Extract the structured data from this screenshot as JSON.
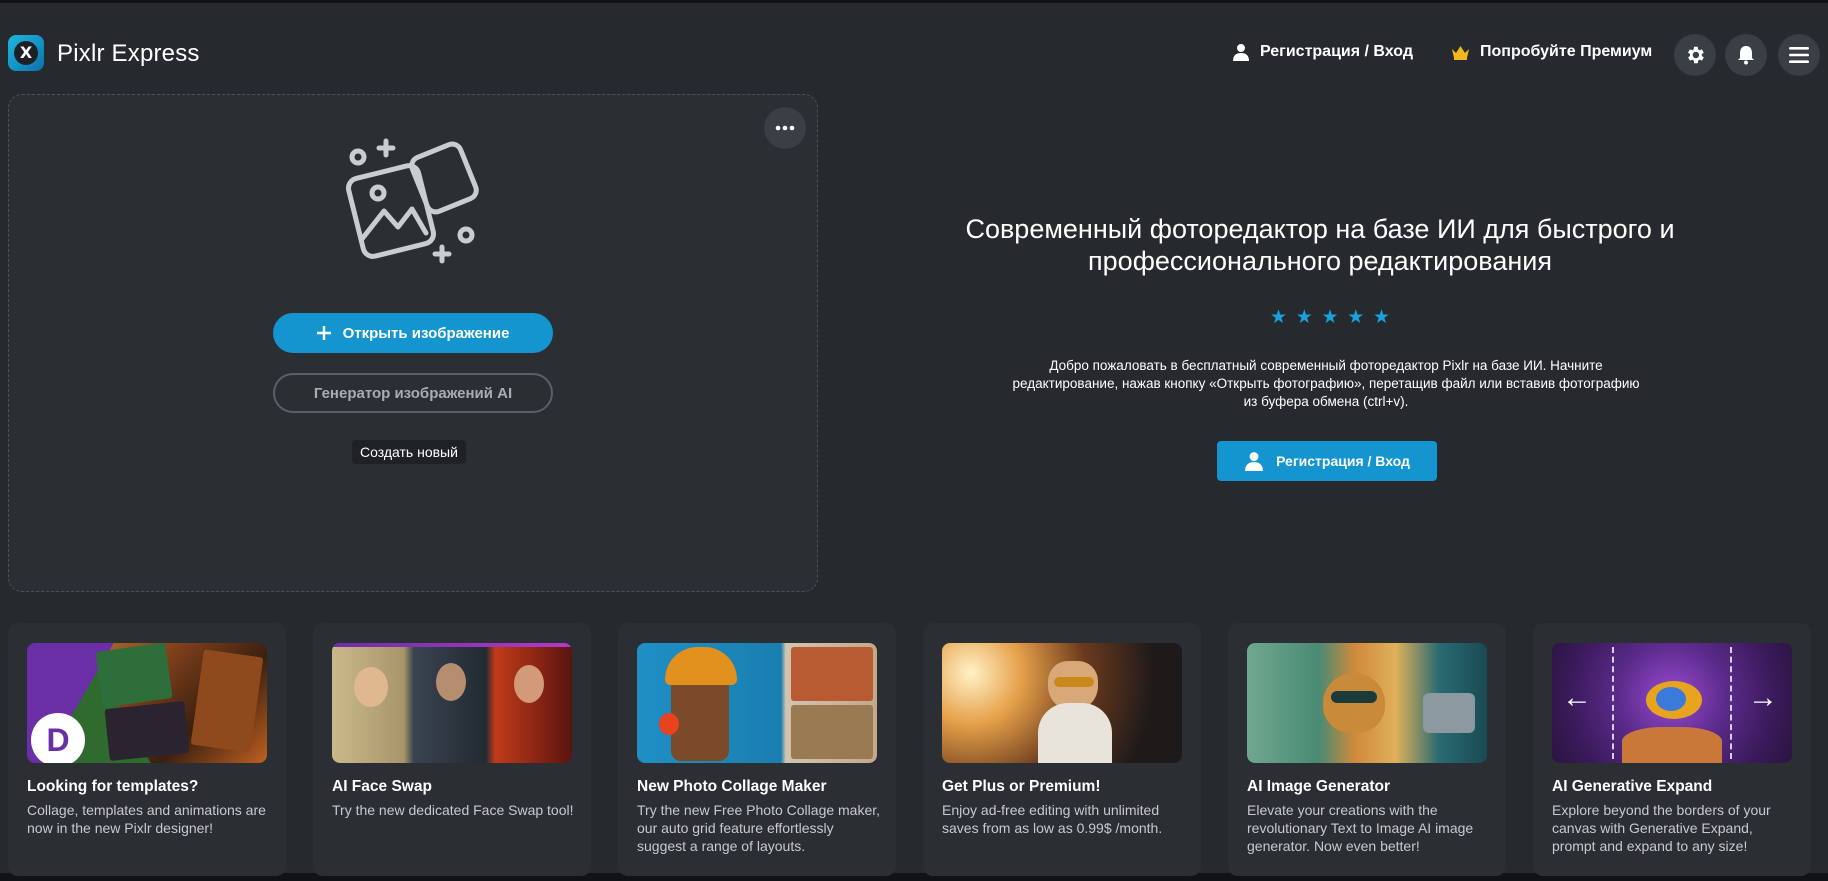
{
  "app": {
    "brand": "Pixlr Express",
    "logo_letter": "X"
  },
  "header": {
    "login_label": "Регистрация / Вход",
    "premium_label": "Попробуйте Премиум",
    "icons": [
      "user-icon",
      "crown-icon",
      "gear-icon",
      "bell-icon",
      "menu-icon"
    ]
  },
  "open_panel": {
    "open_button": "Открыть изображение",
    "ai_generator_button": "Генератор изображений AI",
    "create_new": "Создать новый"
  },
  "hero": {
    "title": "Современный фоторедактор на базе ИИ для быстрого и профессионального редактирования",
    "stars": [
      "★",
      "★",
      "★",
      "★",
      "★"
    ],
    "description": "Добро пожаловать в бесплатный современный фоторедактор Pixlr на базе ИИ. Начните редактирование, нажав кнопку «Открыть фотографию», перетащив файл или вставив фотографию из буфера обмена (ctrl+v).",
    "register_button": "Регистрация / Вход"
  },
  "cards": [
    {
      "title": "Looking for templates?",
      "desc": "Collage, templates and animations are now in the new Pixlr designer!",
      "badge": "D"
    },
    {
      "title": "AI Face Swap",
      "desc": "Try the new dedicated Face Swap tool!"
    },
    {
      "title": "New Photo Collage Maker",
      "desc": "Try the new Free Photo Collage maker, our auto grid feature effortlessly suggest a range of layouts."
    },
    {
      "title": "Get Plus or Premium!",
      "desc": "Enjoy ad-free editing with unlimited saves from as low as 0.99$ /month."
    },
    {
      "title": "AI Image Generator",
      "desc": "Elevate your creations with the revolutionary Text to Image AI image generator. Now even better!"
    },
    {
      "title": "AI Generative Expand",
      "desc": "Explore beyond the borders of your canvas with Generative Expand, prompt and expand to any size!",
      "arrow_left": "←",
      "arrow_right": "→"
    }
  ],
  "colors": {
    "background": "#26292e",
    "panel": "#2b2e33",
    "accent": "#1595cf",
    "star": "#1aa0dd",
    "crown": "#f1b91f"
  }
}
